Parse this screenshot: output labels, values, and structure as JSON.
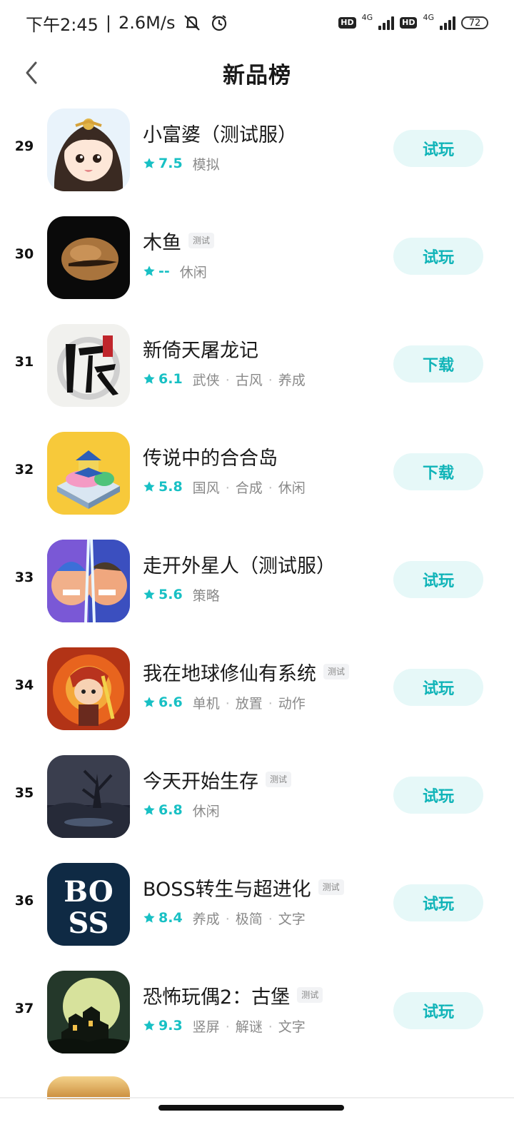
{
  "status_bar": {
    "time": "下午2:45",
    "separator": "|",
    "speed": "2.6M/s",
    "hd1": "HD",
    "net1": "4G",
    "hd2": "HD",
    "net2": "4G",
    "battery": "72"
  },
  "header": {
    "title": "新品榜"
  },
  "colors": {
    "accent": "#18c0c4",
    "button_bg": "#e6f8f8",
    "button_text": "#10b4b8"
  },
  "apps": [
    {
      "rank": "29",
      "name": "小富婆（测试服）",
      "test_tag": "",
      "rating": "7.5",
      "tags": [
        "模拟"
      ],
      "button": "试玩",
      "icon": "anime-girl-icon"
    },
    {
      "rank": "30",
      "name": "木鱼",
      "test_tag": "测试",
      "rating": "--",
      "tags": [
        "休闲"
      ],
      "button": "试玩",
      "icon": "wooden-fish-icon"
    },
    {
      "rank": "31",
      "name": "新倚天屠龙记",
      "test_tag": "",
      "rating": "6.1",
      "tags": [
        "武侠",
        "古风",
        "养成"
      ],
      "button": "下载",
      "icon": "calligraphy-icon"
    },
    {
      "rank": "32",
      "name": "传说中的合合岛",
      "test_tag": "",
      "rating": "5.8",
      "tags": [
        "国风",
        "合成",
        "休闲"
      ],
      "button": "下载",
      "icon": "island-temple-icon"
    },
    {
      "rank": "33",
      "name": "走开外星人（测试服）",
      "test_tag": "",
      "rating": "5.6",
      "tags": [
        "策略"
      ],
      "button": "试玩",
      "icon": "versus-fighters-icon"
    },
    {
      "rank": "34",
      "name": "我在地球修仙有系统",
      "test_tag": "测试",
      "rating": "6.6",
      "tags": [
        "单机",
        "放置",
        "动作"
      ],
      "button": "试玩",
      "icon": "fire-warrior-icon"
    },
    {
      "rank": "35",
      "name": "今天开始生存",
      "test_tag": "测试",
      "rating": "6.8",
      "tags": [
        "休闲"
      ],
      "button": "试玩",
      "icon": "dark-forest-icon"
    },
    {
      "rank": "36",
      "name": "BOSS转生与超进化",
      "test_tag": "测试",
      "rating": "8.4",
      "tags": [
        "养成",
        "极简",
        "文字"
      ],
      "button": "试玩",
      "icon": "boss-logo-icon",
      "icon_text_top": "BO",
      "icon_text_bottom": "SS"
    },
    {
      "rank": "37",
      "name": "恐怖玩偶2：古堡",
      "test_tag": "测试",
      "rating": "9.3",
      "tags": [
        "竖屏",
        "解谜",
        "文字"
      ],
      "button": "试玩",
      "icon": "haunted-castle-icon"
    }
  ]
}
